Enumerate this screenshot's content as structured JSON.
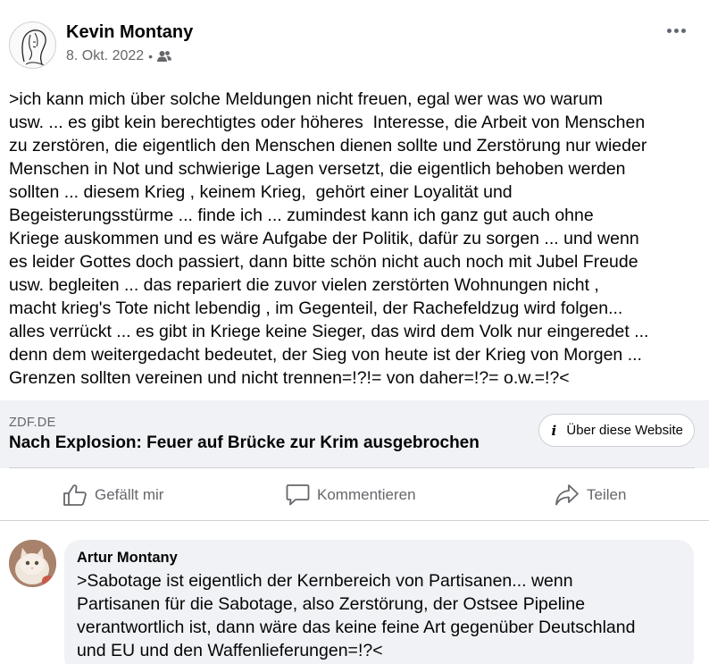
{
  "post": {
    "author": "Kevin Montany",
    "date": "8. Okt. 2022",
    "separator": "•",
    "audience_icon": "friends-icon",
    "more_icon": "more-options-icon",
    "text": ">ich kann mich über solche Meldungen nicht freuen, egal wer was wo warum\nusw. ... es gibt kein berechtigtes oder höheres  Interesse, die Arbeit von Menschen\nzu zerstören, die eigentlich den Menschen dienen sollte und Zerstörung nur wieder\nMenschen in Not und schwierige Lagen versetzt, die eigentlich behoben werden\nsollten ... diesem Krieg , keinem Krieg,  gehört einer Loyalität und\nBegeisterungsstürme ... finde ich ... zumindest kann ich ganz gut auch ohne\nKriege auskommen und es wäre Aufgabe der Politik, dafür zu sorgen ... und wenn\nes leider Gottes doch passiert, dann bitte schön nicht auch noch mit Jubel Freude\nusw. begleiten ... das repariert die zuvor vielen zerstörten Wohnungen nicht ,\nmacht krieg's Tote nicht lebendig , im Gegenteil, der Rachefeldzug wird folgen...\nalles verrückt ... es gibt in Kriege keine Sieger, das wird dem Volk nur eingeredet ...\ndenn dem weitergedacht bedeutet, der Sieg von heute ist der Krieg von Morgen ...\nGrenzen sollten vereinen und nicht trennen=!?!= von daher=!?= o.w.=!?<"
  },
  "link": {
    "domain": "ZDF.DE",
    "title": "Nach Explosion: Feuer auf Brücke zur Krim ausgebrochen",
    "about_label": "Über diese Website",
    "about_icon": "info-icon"
  },
  "actions": {
    "like_label": "Gefällt mir",
    "comment_label": "Kommentieren",
    "share_label": "Teilen"
  },
  "comment": {
    "author": "Artur Montany",
    "text": ">Sabotage ist eigentlich der Kernbereich von Partisanen... wenn\nPartisanen für die Sabotage, also Zerstörung, der Ostsee Pipeline\nverantwortlich ist, dann wäre das keine feine Art gegenüber Deutschland\nund EU und den Waffenlieferungen=!?<"
  },
  "colors": {
    "text": "#050505",
    "secondary": "#65676b",
    "card_bg": "#f0f2f5",
    "divider": "#ced0d4"
  }
}
